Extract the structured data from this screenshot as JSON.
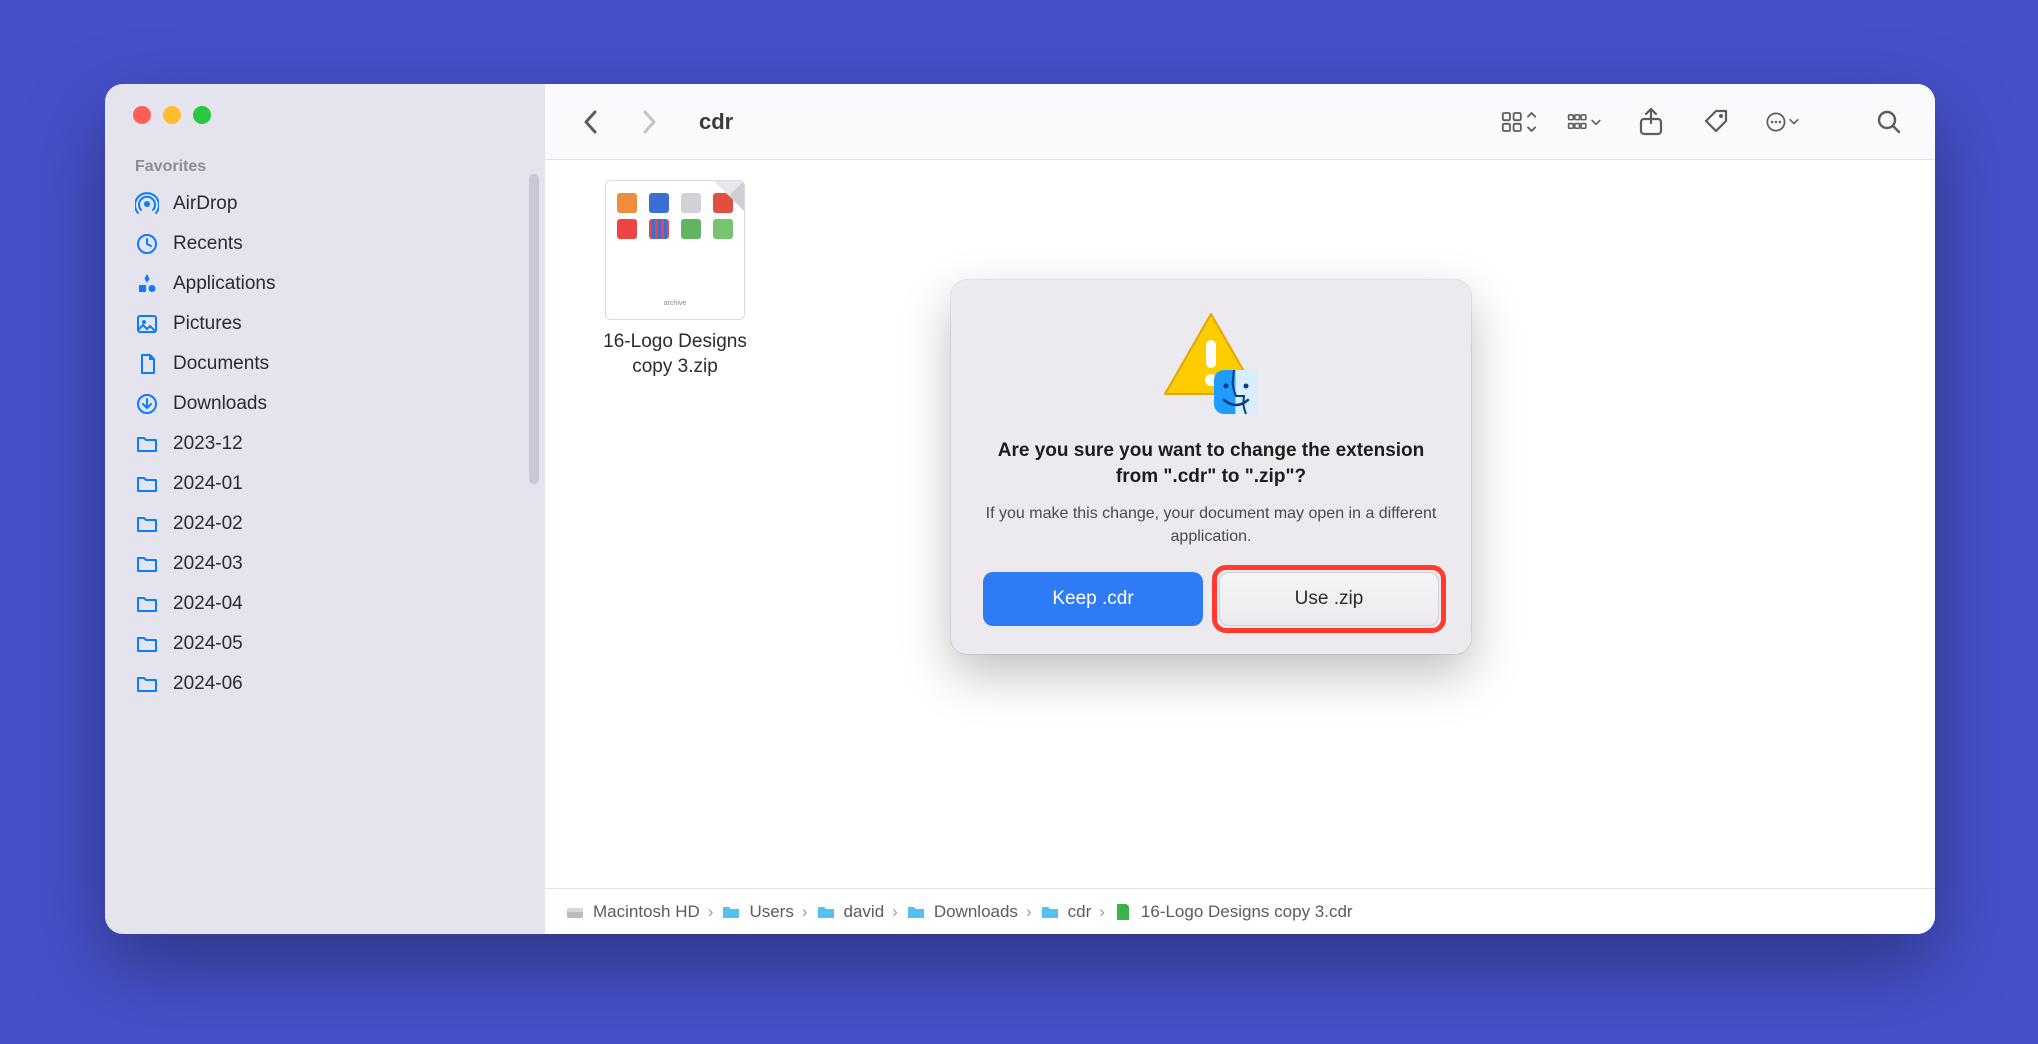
{
  "sidebar": {
    "section": "Favorites",
    "items": [
      {
        "icon": "airdrop",
        "label": "AirDrop"
      },
      {
        "icon": "clock",
        "label": "Recents"
      },
      {
        "icon": "apps",
        "label": "Applications"
      },
      {
        "icon": "picture",
        "label": "Pictures"
      },
      {
        "icon": "doc",
        "label": "Documents"
      },
      {
        "icon": "download",
        "label": "Downloads"
      },
      {
        "icon": "folder",
        "label": "2023-12"
      },
      {
        "icon": "folder",
        "label": "2024-01"
      },
      {
        "icon": "folder",
        "label": "2024-02"
      },
      {
        "icon": "folder",
        "label": "2024-03"
      },
      {
        "icon": "folder",
        "label": "2024-04"
      },
      {
        "icon": "folder",
        "label": "2024-05"
      },
      {
        "icon": "folder",
        "label": "2024-06"
      }
    ]
  },
  "toolbar": {
    "title": "cdr"
  },
  "file": {
    "name": "16-Logo Designs\ncopy 3.zip"
  },
  "dialog": {
    "title": "Are you sure you want to change the extension from \".cdr\" to \".zip\"?",
    "message": "If you make this change, your document may open in a different application.",
    "keep": "Keep .cdr",
    "use": "Use .zip"
  },
  "path": [
    {
      "icon": "disk",
      "label": "Macintosh HD"
    },
    {
      "icon": "folder",
      "label": "Users"
    },
    {
      "icon": "folder",
      "label": "david"
    },
    {
      "icon": "folder",
      "label": "Downloads"
    },
    {
      "icon": "folder",
      "label": "cdr"
    },
    {
      "icon": "zipdoc",
      "label": "16-Logo Designs copy 3.cdr"
    }
  ]
}
